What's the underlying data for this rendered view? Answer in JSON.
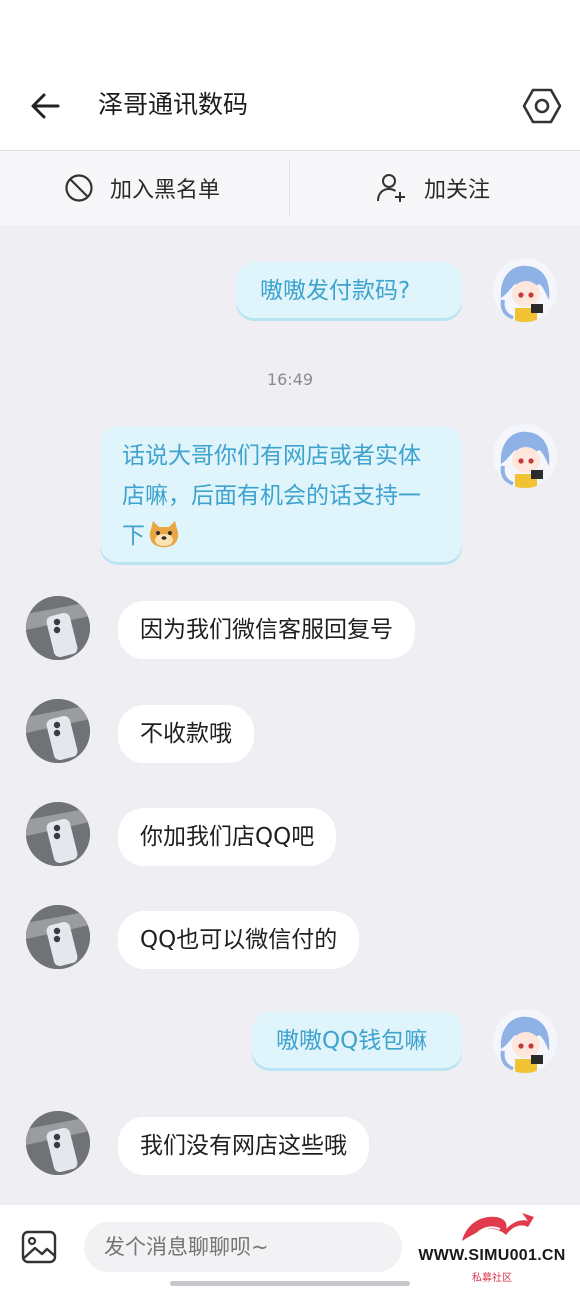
{
  "header": {
    "title": "泽哥通讯数码",
    "back_icon": "arrow-left-icon",
    "settings_icon": "hexagon-settings-icon"
  },
  "actions": {
    "block_label": "加入黑名单",
    "block_icon": "ban-icon",
    "follow_label": "加关注",
    "follow_icon": "add-user-icon"
  },
  "messages": [
    {
      "side": "out",
      "text": "嗷嗷发付款码?"
    },
    {
      "timestamp": "16:49"
    },
    {
      "side": "out",
      "text": "话说大哥你们有网店或者实体店嘛，后面有机会的话支持一下",
      "emoji": "doge-emoji"
    },
    {
      "side": "in",
      "text": "因为我们微信客服回复号"
    },
    {
      "side": "in",
      "text": "不收款哦"
    },
    {
      "side": "in",
      "text": "你加我们店QQ吧"
    },
    {
      "side": "in",
      "text": "QQ也可以微信付的"
    },
    {
      "side": "out",
      "text": "嗷嗷QQ钱包嘛"
    },
    {
      "side": "in",
      "text": "我们没有网店这些哦"
    }
  ],
  "composer": {
    "placeholder": "发个消息聊聊呗~",
    "image_icon": "image-icon"
  },
  "watermark": {
    "text": "WWW.SIMU001.CN",
    "sub": "私募社区"
  },
  "colors": {
    "out_bubble": "#dff4fb",
    "out_text": "#3ea3ce",
    "in_bubble": "#ffffff",
    "background": "#efeff3"
  }
}
